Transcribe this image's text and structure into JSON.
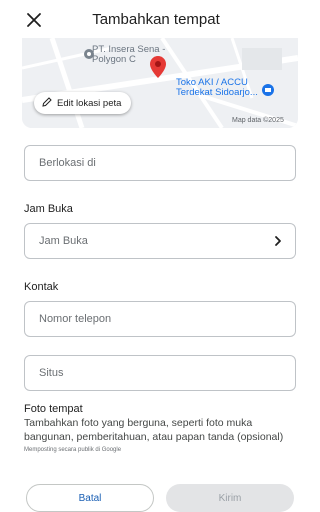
{
  "header": {
    "title": "Tambahkan tempat"
  },
  "map": {
    "poi_1_line1": "PT. Insera Sena -",
    "poi_1_line2": "Polygon C",
    "poi_2_line1": "Toko AKI / ACCU",
    "poi_2_line2": "Terdekat Sidoarjo...",
    "attribution": "Map data ©2025",
    "edit_label": "Edit lokasi peta",
    "pin_color": "#e53935",
    "poi_blue": "#1a73e8"
  },
  "form": {
    "location_placeholder": "Berlokasi di",
    "hours_section": "Jam Buka",
    "hours_placeholder": "Jam Buka",
    "contact_section": "Kontak",
    "phone_placeholder": "Nomor telepon",
    "website_placeholder": "Situs",
    "photo_title": "Foto tempat",
    "photo_description": "Tambahkan foto yang berguna, seperti foto muka bangunan, pemberitahuan, atau papan tanda (opsional)",
    "photo_note": "Memposting secara publik di Google"
  },
  "footer": {
    "cancel_label": "Batal",
    "submit_label": "Kirim"
  },
  "icons": {
    "close": "close-icon",
    "edit": "edit-pencil-icon",
    "chevron": "chevron-right-icon",
    "pin": "map-pin-icon"
  }
}
